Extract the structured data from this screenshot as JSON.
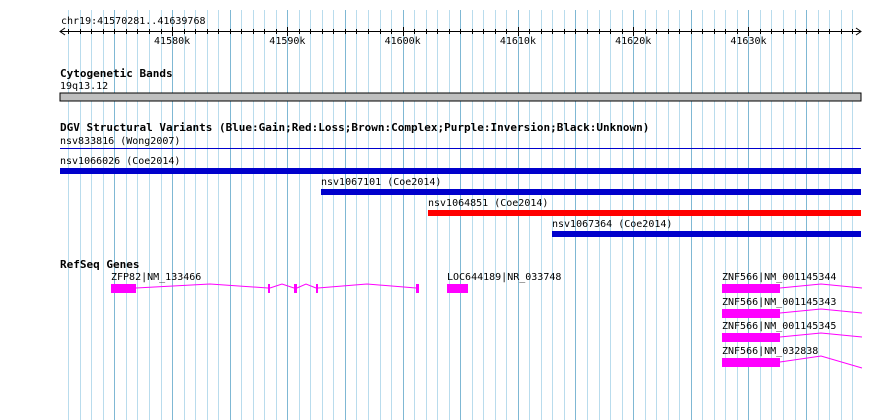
{
  "ruler": {
    "location": "chr19:41570281..41639768",
    "start": 41570281,
    "end": 41639768,
    "tick_labels": [
      "41580k",
      "41590k",
      "41600k",
      "41610k",
      "41620k",
      "41630k"
    ],
    "tick_values": [
      41580000,
      41590000,
      41600000,
      41610000,
      41620000,
      41630000
    ]
  },
  "tracks": {
    "cytobands": {
      "title": "Cytogenetic Bands",
      "band": "19q13.12"
    },
    "dgv": {
      "title": "DGV Structural Variants (Blue:Gain;Red:Loss;Brown:Complex;Purple:Inversion;Black:Unknown)",
      "features": [
        {
          "label": "nsv833816 (Wong2007)",
          "start": 41570281,
          "end": 41639768,
          "color": "#0000cc",
          "thin": true
        },
        {
          "label": "nsv1066026 (Coe2014)",
          "start": 41570281,
          "end": 41639768,
          "color": "#0000cc"
        },
        {
          "label": "nsv1067101 (Coe2014)",
          "start": 41592900,
          "end": 41639768,
          "color": "#0000cc"
        },
        {
          "label": "nsv1064851 (Coe2014)",
          "start": 41602200,
          "end": 41639768,
          "color": "#ff0000"
        },
        {
          "label": "nsv1067364 (Coe2014)",
          "start": 41613000,
          "end": 41639768,
          "color": "#0000cc"
        }
      ]
    },
    "refseq": {
      "title": "RefSeq Genes",
      "color": "#ff00ff",
      "genes": [
        {
          "label": "ZFP82|NM_133466"
        },
        {
          "label": "LOC644189|NR_033748"
        },
        {
          "label": "ZNF566|NM_001145344"
        },
        {
          "label": "ZNF566|NM_001145343"
        },
        {
          "label": "ZNF566|NM_001145345"
        },
        {
          "label": "ZNF566|NM_032838"
        }
      ]
    }
  }
}
